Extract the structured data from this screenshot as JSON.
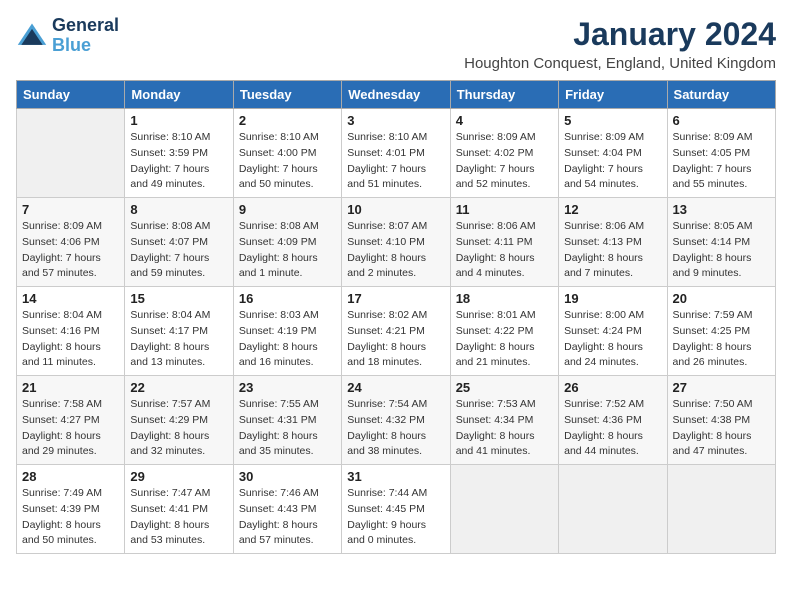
{
  "header": {
    "logo_line1": "General",
    "logo_line2": "Blue",
    "title": "January 2024",
    "subtitle": "Houghton Conquest, England, United Kingdom"
  },
  "days_of_week": [
    "Sunday",
    "Monday",
    "Tuesday",
    "Wednesday",
    "Thursday",
    "Friday",
    "Saturday"
  ],
  "weeks": [
    [
      {
        "num": "",
        "sunrise": "",
        "sunset": "",
        "daylight": "",
        "empty": true
      },
      {
        "num": "1",
        "sunrise": "8:10 AM",
        "sunset": "3:59 PM",
        "daylight": "7 hours and 49 minutes."
      },
      {
        "num": "2",
        "sunrise": "8:10 AM",
        "sunset": "4:00 PM",
        "daylight": "7 hours and 50 minutes."
      },
      {
        "num": "3",
        "sunrise": "8:10 AM",
        "sunset": "4:01 PM",
        "daylight": "7 hours and 51 minutes."
      },
      {
        "num": "4",
        "sunrise": "8:09 AM",
        "sunset": "4:02 PM",
        "daylight": "7 hours and 52 minutes."
      },
      {
        "num": "5",
        "sunrise": "8:09 AM",
        "sunset": "4:04 PM",
        "daylight": "7 hours and 54 minutes."
      },
      {
        "num": "6",
        "sunrise": "8:09 AM",
        "sunset": "4:05 PM",
        "daylight": "7 hours and 55 minutes."
      }
    ],
    [
      {
        "num": "7",
        "sunrise": "8:09 AM",
        "sunset": "4:06 PM",
        "daylight": "7 hours and 57 minutes."
      },
      {
        "num": "8",
        "sunrise": "8:08 AM",
        "sunset": "4:07 PM",
        "daylight": "7 hours and 59 minutes."
      },
      {
        "num": "9",
        "sunrise": "8:08 AM",
        "sunset": "4:09 PM",
        "daylight": "8 hours and 1 minute."
      },
      {
        "num": "10",
        "sunrise": "8:07 AM",
        "sunset": "4:10 PM",
        "daylight": "8 hours and 2 minutes."
      },
      {
        "num": "11",
        "sunrise": "8:06 AM",
        "sunset": "4:11 PM",
        "daylight": "8 hours and 4 minutes."
      },
      {
        "num": "12",
        "sunrise": "8:06 AM",
        "sunset": "4:13 PM",
        "daylight": "8 hours and 7 minutes."
      },
      {
        "num": "13",
        "sunrise": "8:05 AM",
        "sunset": "4:14 PM",
        "daylight": "8 hours and 9 minutes."
      }
    ],
    [
      {
        "num": "14",
        "sunrise": "8:04 AM",
        "sunset": "4:16 PM",
        "daylight": "8 hours and 11 minutes."
      },
      {
        "num": "15",
        "sunrise": "8:04 AM",
        "sunset": "4:17 PM",
        "daylight": "8 hours and 13 minutes."
      },
      {
        "num": "16",
        "sunrise": "8:03 AM",
        "sunset": "4:19 PM",
        "daylight": "8 hours and 16 minutes."
      },
      {
        "num": "17",
        "sunrise": "8:02 AM",
        "sunset": "4:21 PM",
        "daylight": "8 hours and 18 minutes."
      },
      {
        "num": "18",
        "sunrise": "8:01 AM",
        "sunset": "4:22 PM",
        "daylight": "8 hours and 21 minutes."
      },
      {
        "num": "19",
        "sunrise": "8:00 AM",
        "sunset": "4:24 PM",
        "daylight": "8 hours and 24 minutes."
      },
      {
        "num": "20",
        "sunrise": "7:59 AM",
        "sunset": "4:25 PM",
        "daylight": "8 hours and 26 minutes."
      }
    ],
    [
      {
        "num": "21",
        "sunrise": "7:58 AM",
        "sunset": "4:27 PM",
        "daylight": "8 hours and 29 minutes."
      },
      {
        "num": "22",
        "sunrise": "7:57 AM",
        "sunset": "4:29 PM",
        "daylight": "8 hours and 32 minutes."
      },
      {
        "num": "23",
        "sunrise": "7:55 AM",
        "sunset": "4:31 PM",
        "daylight": "8 hours and 35 minutes."
      },
      {
        "num": "24",
        "sunrise": "7:54 AM",
        "sunset": "4:32 PM",
        "daylight": "8 hours and 38 minutes."
      },
      {
        "num": "25",
        "sunrise": "7:53 AM",
        "sunset": "4:34 PM",
        "daylight": "8 hours and 41 minutes."
      },
      {
        "num": "26",
        "sunrise": "7:52 AM",
        "sunset": "4:36 PM",
        "daylight": "8 hours and 44 minutes."
      },
      {
        "num": "27",
        "sunrise": "7:50 AM",
        "sunset": "4:38 PM",
        "daylight": "8 hours and 47 minutes."
      }
    ],
    [
      {
        "num": "28",
        "sunrise": "7:49 AM",
        "sunset": "4:39 PM",
        "daylight": "8 hours and 50 minutes."
      },
      {
        "num": "29",
        "sunrise": "7:47 AM",
        "sunset": "4:41 PM",
        "daylight": "8 hours and 53 minutes."
      },
      {
        "num": "30",
        "sunrise": "7:46 AM",
        "sunset": "4:43 PM",
        "daylight": "8 hours and 57 minutes."
      },
      {
        "num": "31",
        "sunrise": "7:44 AM",
        "sunset": "4:45 PM",
        "daylight": "9 hours and 0 minutes."
      },
      {
        "num": "",
        "sunrise": "",
        "sunset": "",
        "daylight": "",
        "empty": true
      },
      {
        "num": "",
        "sunrise": "",
        "sunset": "",
        "daylight": "",
        "empty": true
      },
      {
        "num": "",
        "sunrise": "",
        "sunset": "",
        "daylight": "",
        "empty": true
      }
    ]
  ]
}
